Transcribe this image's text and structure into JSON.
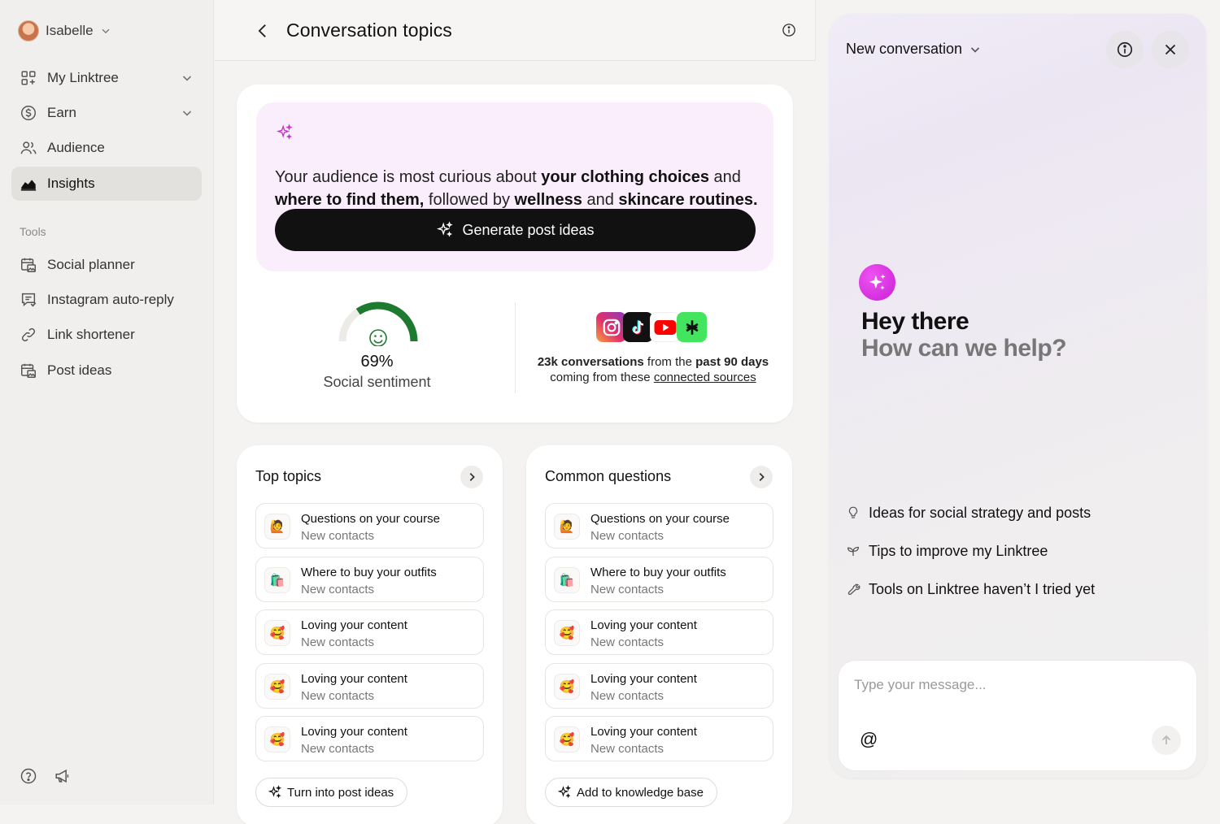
{
  "sidebar": {
    "user": {
      "name": "Isabelle"
    },
    "items": [
      {
        "label": "My Linktree",
        "icon": "grid-plus-icon"
      },
      {
        "label": "Earn",
        "icon": "dollar-circle-icon"
      },
      {
        "label": "Audience",
        "icon": "users-icon"
      },
      {
        "label": "Insights",
        "icon": "chart-area-icon"
      }
    ],
    "tools_heading": "Tools",
    "tools": [
      {
        "label": "Social planner",
        "icon": "calendar-image-icon"
      },
      {
        "label": "Instagram auto-reply",
        "icon": "chat-reply-icon"
      },
      {
        "label": "Link shortener",
        "icon": "link-icon"
      },
      {
        "label": "Post ideas",
        "icon": "post-ideas-icon"
      }
    ],
    "bottom": [
      "help-icon",
      "megaphone-icon"
    ]
  },
  "header": {
    "title": "Conversation topics"
  },
  "insight": {
    "s1": "Your audience is most curious about ",
    "b1": "your clothing choices",
    "s2": " and ",
    "b2": "where to find them,",
    "s3": " followed by ",
    "b3": "wellness",
    "s4": " and ",
    "b4": "skincare routines.",
    "button": "Generate post ideas",
    "sentiment_value": "69%",
    "sentiment_fraction": 0.69,
    "sentiment_label": "Social sentiment",
    "conv_bold1": "23k conversations",
    "conv_t1": " from the ",
    "conv_bold2": "past 90 days",
    "conv_t2": " coming from these ",
    "conv_link": "connected sources",
    "sources": [
      "instagram-logo",
      "tiktok-logo",
      "youtube-logo",
      "linktree-logo"
    ]
  },
  "top_topics": {
    "title": "Top topics",
    "items": [
      {
        "title": "Questions on your course",
        "subtitle": "New contacts",
        "emoji": "🙋"
      },
      {
        "title": "Where to buy your outfits",
        "subtitle": "New contacts",
        "emoji": "🛍️"
      },
      {
        "title": "Loving your content",
        "subtitle": "New contacts",
        "emoji": "🥰"
      },
      {
        "title": "Loving your content",
        "subtitle": "New contacts",
        "emoji": "🥰"
      },
      {
        "title": "Loving your content",
        "subtitle": "New contacts",
        "emoji": "🥰"
      }
    ],
    "action": "Turn into post ideas"
  },
  "common_questions": {
    "title": "Common questions",
    "items": [
      {
        "title": "Questions on your course",
        "subtitle": "New contacts",
        "emoji": "🙋"
      },
      {
        "title": "Where to buy your outfits",
        "subtitle": "New contacts",
        "emoji": "🛍️"
      },
      {
        "title": "Loving your content",
        "subtitle": "New contacts",
        "emoji": "🥰"
      },
      {
        "title": "Loving your content",
        "subtitle": "New contacts",
        "emoji": "🥰"
      },
      {
        "title": "Loving your content",
        "subtitle": "New contacts",
        "emoji": "🥰"
      }
    ],
    "action": "Add to knowledge base"
  },
  "chat": {
    "selector": "New conversation",
    "greeting": "Hey there",
    "subgreeting": "How can we help?",
    "suggestions": [
      {
        "label": "Ideas for social strategy and posts",
        "icon": "lightbulb-icon"
      },
      {
        "label": "Tips to improve my Linktree",
        "icon": "sprout-icon"
      },
      {
        "label": "Tools on Linktree haven’t I tried yet",
        "icon": "wrench-icon"
      }
    ],
    "input_placeholder": "Type your message...",
    "mention_symbol": "@"
  },
  "colors": {
    "accent_pink": "#c81fd6",
    "sentiment_green": "#1d7a2e",
    "primary_button": "#111111"
  }
}
